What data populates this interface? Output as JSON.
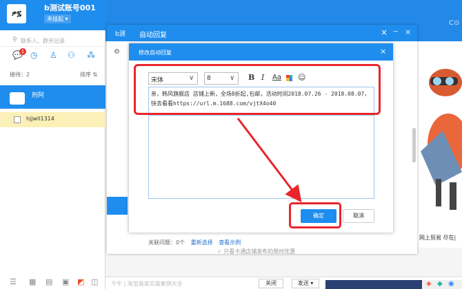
{
  "account": {
    "avatar_text": "ዎ፯",
    "name": "b测试账号001",
    "status": "未挂起 ▾"
  },
  "left": {
    "search_placeholder": "联系人、群天记录",
    "badge": "1",
    "wait_label": "接待：2",
    "sort_label": "排序 ⇅",
    "contacts": [
      {
        "name": "刑阿"
      },
      {
        "name": "hjjwll1314"
      }
    ]
  },
  "outer_dialog": {
    "b_label": "b测",
    "title": "自动回复",
    "close": "×",
    "minimize": "−",
    "close2": "×",
    "footer_text": "关联问题：0个",
    "footer_link1": "重新选择",
    "footer_link2": "查看示例",
    "hint": "✓ 只看卡通店铺发布的限时优惠"
  },
  "inner_dialog": {
    "title": "修改自动回复",
    "close": "×",
    "toolbar": {
      "font": "宋体",
      "size": "8",
      "bold": "B",
      "italic": "I",
      "aa": "Aa",
      "emoji": "☺",
      "arrow": "∨"
    },
    "content": "亲，韩风旗舰店 店铺上新，全场8折起,包邮，活动时间2018.07.26 - 2018.08.07，快去看看https://url.m.1688.com/vjtX4o40",
    "ok": "确定",
    "cancel": "取消"
  },
  "bottom": {
    "hint": "千牛 | 淘宝商家实操案例大全",
    "close": "关闭",
    "send": "发送 ▾"
  },
  "side": {
    "trade_text": "网上贸易 尽在|",
    "corner": "C⊙"
  },
  "colors": {
    "primary": "#1f8ded",
    "annotation": "#e8252a",
    "highlight": "#fbf1b8"
  }
}
